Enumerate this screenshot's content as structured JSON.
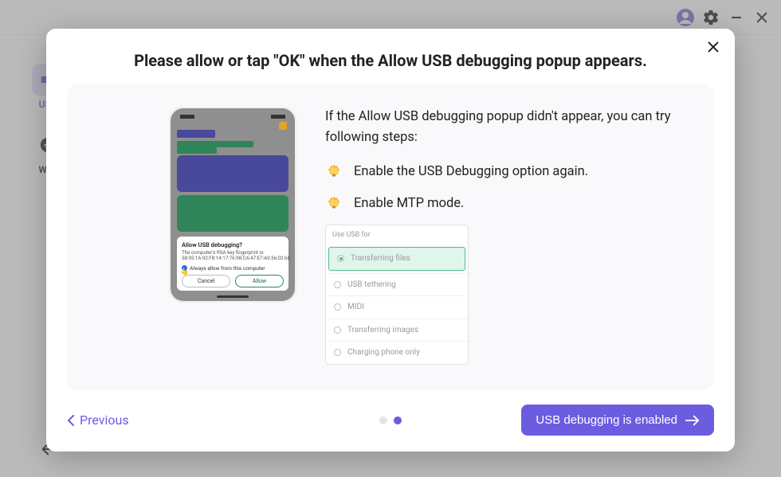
{
  "window": {
    "avatar_color": "#8c6fd6"
  },
  "sidebar": {
    "items": [
      {
        "label": "USB"
      },
      {
        "label": "WiFi"
      }
    ]
  },
  "modal": {
    "title": "Please allow or tap \"OK\" when the Allow USB debugging popup appears.",
    "intro": "If the Allow USB debugging popup didn't appear, you can try following steps:",
    "steps": [
      {
        "text": "Enable the USB Debugging option again."
      },
      {
        "text": "Enable MTP mode."
      }
    ],
    "usb_widget": {
      "header": "Use USB for",
      "options": [
        {
          "label": "Transferring files",
          "selected": true
        },
        {
          "label": "USB tethering",
          "selected": false
        },
        {
          "label": "MIDI",
          "selected": false
        },
        {
          "label": "Transferring images",
          "selected": false
        },
        {
          "label": "Charging phone only",
          "selected": false
        }
      ]
    },
    "phone_dialog": {
      "title": "Allow USB debugging?",
      "line1": "The computer's RSA key fingerprint is:",
      "line2": "58:95:1A:92:F8:14:17:76:98:CA:47:E7:A0:56:02:68",
      "checkbox": "Always allow from this computer",
      "cancel": "Cancel",
      "allow": "Allow"
    },
    "footer": {
      "previous": "Previous",
      "next": "USB debugging is enabled",
      "active_step": 2,
      "total_steps": 2
    }
  },
  "colors": {
    "accent": "#6b5ce0"
  }
}
